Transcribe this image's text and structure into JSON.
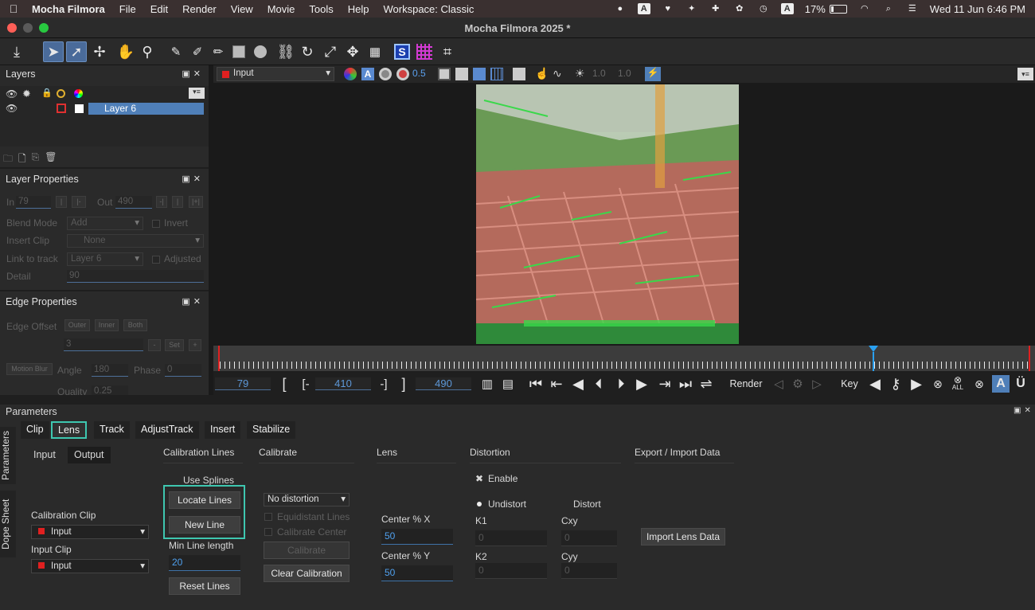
{
  "menubar": {
    "app_name": "Mocha Filmora",
    "items": [
      "File",
      "Edit",
      "Render",
      "View",
      "Movie",
      "Tools",
      "Help",
      "Workspace: Classic"
    ],
    "battery_percent": "17%",
    "battery_level": 0.17,
    "datetime": "Wed 11 Jun  6:46 PM",
    "input_indicator": "A"
  },
  "window": {
    "title": "Mocha Filmora 2025 *"
  },
  "layers_panel": {
    "title": "Layers",
    "layer_name": "Layer 6"
  },
  "layer_properties": {
    "title": "Layer Properties",
    "in_label": "In",
    "in_value": "79",
    "out_label": "Out",
    "out_value": "490",
    "blend_mode_label": "Blend Mode",
    "blend_mode_value": "Add",
    "invert_label": "Invert",
    "insert_clip_label": "Insert Clip",
    "insert_clip_value": "None",
    "link_to_track_label": "Link to track",
    "link_to_track_value": "Layer 6",
    "adjusted_label": "Adjusted",
    "detail_label": "Detail",
    "detail_value": "90"
  },
  "edge_properties": {
    "title": "Edge Properties",
    "edge_offset_label": "Edge Offset",
    "outer": "Outer",
    "inner": "Inner",
    "both": "Both",
    "offset_value": "3",
    "set_label": "Set",
    "motion_blur": "Motion Blur",
    "angle_label": "Angle",
    "angle_value": "180",
    "phase_label": "Phase",
    "phase_value": "0",
    "quality_label": "Quality",
    "quality_value": "0.25"
  },
  "viewer_bar": {
    "input_select": "Input",
    "opacity_value": "0.5",
    "gamma_value": "1.0",
    "gain_value": "1.0"
  },
  "transport": {
    "current_frame": "79",
    "in_frame": "410",
    "out_frame": "490",
    "render_label": "Render",
    "key_label": "Key",
    "all_label": "ALL"
  },
  "parameters": {
    "title": "Parameters",
    "tabs": [
      "Clip",
      "Lens",
      "Track",
      "AdjustTrack",
      "Insert",
      "Stabilize"
    ],
    "selected_tab": "Lens",
    "side_tabs": [
      "Parameters",
      "Dope Sheet"
    ],
    "subtabs": [
      "Input",
      "Output"
    ],
    "sections": {
      "calibration_lines": "Calibration Lines",
      "calibrate": "Calibrate",
      "lens": "Lens",
      "distortion": "Distortion",
      "export_import": "Export / Import Data"
    },
    "calibration_clip_label": "Calibration Clip",
    "calibration_clip_value": "Input",
    "input_clip_label": "Input Clip",
    "input_clip_value": "Input",
    "use_splines": "Use Splines",
    "locate_lines": "Locate Lines",
    "new_line": "New Line",
    "min_line_length_label": "Min Line length",
    "min_line_length_value": "20",
    "reset_lines": "Reset Lines",
    "distortion_mode": "No distortion",
    "equidistant_lines": "Equidistant Lines",
    "calibrate_center": "Calibrate Center",
    "calibrate_button": "Calibrate",
    "clear_calibration": "Clear Calibration",
    "center_x_label": "Center % X",
    "center_x_value": "50",
    "center_y_label": "Center % Y",
    "center_y_value": "50",
    "enable_label": "Enable",
    "enable_mark": "✖",
    "undistort_label": "Undistort",
    "distort_label": "Distort",
    "k1_label": "K1",
    "k1_value": "0",
    "k2_label": "K2",
    "k2_value": "0",
    "cxy_label": "Cxy",
    "cxy_value": "0",
    "cyy_label": "Cyy",
    "cyy_value": "0",
    "import_lens_data": "Import Lens Data"
  },
  "colors": {
    "accent_teal": "#3ec7b0",
    "value_blue": "#4fa0ee",
    "selection_blue": "#4f7fb8"
  }
}
